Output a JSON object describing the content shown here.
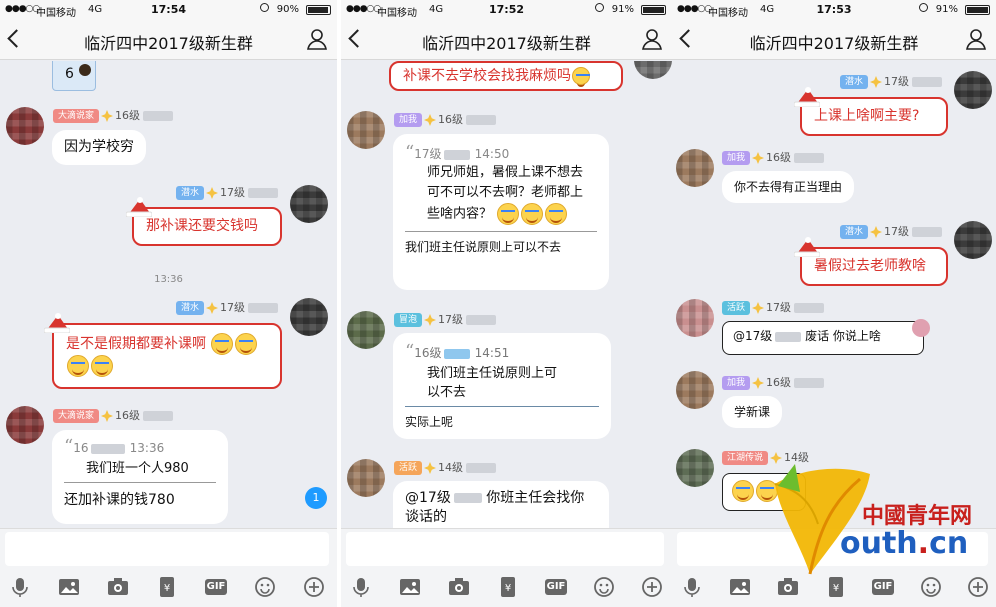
{
  "colors": {
    "accent_red": "#d8342e",
    "blue_bubble": "#aad9fb",
    "badge_blue": "#74b2ef",
    "unread_blue": "#1e9bff",
    "brand_red": "#c8201d",
    "brand_blue": "#1f5fbf"
  },
  "watermark": {
    "brand_cn": "中國青年网",
    "brand_en_main": "outh",
    "brand_en_dot": ".",
    "brand_en_tld": "cn"
  },
  "screens": [
    {
      "status": {
        "signal": "●●●○○",
        "carrier": "中国移动",
        "network": "4G",
        "time": "17:54",
        "battery": "90%",
        "battery_level": 0.9
      },
      "title": "临沂四中2017级新生群",
      "messages": {
        "m1_badge": "大滴说家",
        "m1_level": "16级",
        "m1_text": "因为学校穷",
        "m2_badge": "潜水",
        "m2_level": "17级",
        "m2_text": "那补课还要交钱吗",
        "time_sep": "13:36",
        "m3_badge": "潜水",
        "m3_level": "17级",
        "m3_text": "是不是假期都要补课啊",
        "m4_badge": "大滴说家",
        "m4_level": "16级",
        "m4_quote_head_level": "16",
        "m4_quote_head_time": "13:36",
        "m4_quote_text": "我们班一个人980",
        "m4_text": "还加补课的钱780",
        "unread": "1"
      }
    },
    {
      "status": {
        "signal": "●●●○○",
        "carrier": "中国移动",
        "network": "4G",
        "time": "17:52",
        "battery": "91%",
        "battery_level": 0.91
      },
      "title": "临沂四中2017级新生群",
      "messages": {
        "m0_text": "补课不去学校会找我麻烦吗",
        "m1_badge": "加我",
        "m1_level": "16级",
        "m1_quote_head_level": "17级",
        "m1_quote_head_time": "14:50",
        "m1_quote_text": "师兄师姐，暑假上课不想去可不可以不去啊？老师都上些啥内容？",
        "m1_text": "我们班主任说原则上可以不去",
        "m2_badge": "冒泡",
        "m2_level": "17级",
        "m2_quote_head_level": "16级",
        "m2_quote_head_time": "14:51",
        "m2_quote_text": "我们班主任说原则上可以不去",
        "m2_text": "实际上呢",
        "m3_badge": "活跃",
        "m3_level": "14级",
        "m3_text_a": "@17级",
        "m3_text_b": "你班主任会找你谈话的"
      }
    },
    {
      "status": {
        "signal": "●●●○○",
        "carrier": "中国移动",
        "network": "4G",
        "time": "17:53",
        "battery": "91%",
        "battery_level": 0.91
      },
      "title": "临沂四中2017级新生群",
      "messages": {
        "m1_badge": "潜水",
        "m1_level": "17级",
        "m1_text": "上课上啥啊主要?",
        "m2_badge": "加我",
        "m2_level": "16级",
        "m2_text": "你不去得有正当理由",
        "m3_badge": "潜水",
        "m3_level": "17级",
        "m3_text": "暑假过去老师教啥",
        "m4_badge": "活跃",
        "m4_level": "17级",
        "m4_text_a": "@17级",
        "m4_text_b": "废话  你说上啥",
        "m5_badge": "加我",
        "m5_level": "16级",
        "m5_text": "学新课",
        "m6_badge": "江湖传说",
        "m6_level": "14级"
      }
    }
  ]
}
